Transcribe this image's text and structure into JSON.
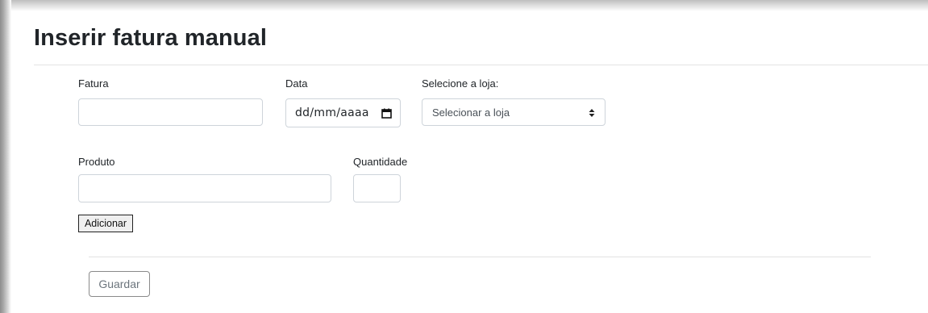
{
  "page": {
    "title": "Inserir fatura manual"
  },
  "form": {
    "invoice": {
      "label": "Fatura",
      "value": "",
      "placeholder": ""
    },
    "date": {
      "label": "Data",
      "value": "dd/mm/aaaa",
      "icon": "calendar-icon"
    },
    "store": {
      "label": "Selecione a loja:",
      "selected": "Selecionar a loja",
      "icon": "sort-icon"
    },
    "product": {
      "label": "Produto",
      "value": "",
      "placeholder": ""
    },
    "quantity": {
      "label": "Quantidade",
      "value": "",
      "placeholder": ""
    },
    "add_label": "Adicionar",
    "save_label": "Guardar"
  }
}
